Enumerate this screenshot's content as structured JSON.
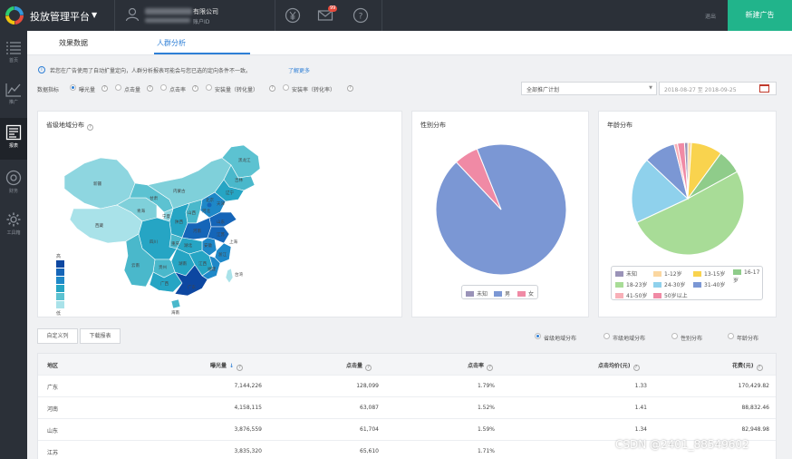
{
  "header": {
    "app_title": "投放管理平台",
    "company": "有限公司",
    "account": "账户ID",
    "mail_badge": "99",
    "top_link": "退出",
    "new_ad_label": "新建广告"
  },
  "sidebar": {
    "items": [
      {
        "label": "首页",
        "icon": "list-icon"
      },
      {
        "label": "推广",
        "icon": "trend-icon"
      },
      {
        "label": "报表",
        "icon": "report-icon",
        "active": true
      },
      {
        "label": "财务",
        "icon": "finance-icon"
      },
      {
        "label": "工具箱",
        "icon": "gear-icon"
      }
    ]
  },
  "tabs": [
    {
      "label": "效果数据"
    },
    {
      "label": "人群分析",
      "active": true
    }
  ],
  "notice": {
    "text": "若您在广告使用了自动扩量定向，人群分析报表可能会与您已选的定向条件不一致。",
    "link": "了解更多"
  },
  "metrics": {
    "label": "数据指标",
    "options": [
      "曝光量",
      "点击量",
      "点击率",
      "安装量（转化量）",
      "安装率（转化率）"
    ],
    "selected": "曝光量"
  },
  "filters": {
    "plan": "全部推广计划",
    "date_range": "2018-08-27 至 2018-09-25"
  },
  "panels": {
    "map_title": "省级地域分布",
    "gender_title": "性别分布",
    "age_title": "年龄分布",
    "map_legend_low": "低",
    "map_legend_high": "高"
  },
  "map_labels": [
    "新疆",
    "西藏",
    "青海",
    "甘肃",
    "内蒙古",
    "黑龙江",
    "吉林",
    "辽宁",
    "宁夏",
    "陕西",
    "山西",
    "河北",
    "北京",
    "天津",
    "山东",
    "河南",
    "四川",
    "重庆",
    "湖北",
    "安徽",
    "江苏",
    "上海",
    "浙江",
    "湖南",
    "江西",
    "贵州",
    "云南",
    "广西",
    "广东",
    "福建",
    "台湾",
    "海南"
  ],
  "gender": {
    "legend": [
      "未知",
      "男",
      "女"
    ],
    "colors": [
      "#9a93b8",
      "#7b97d4",
      "#f08aa5"
    ],
    "values": [
      0,
      94,
      6
    ]
  },
  "age": {
    "legend": [
      "未知",
      "1-12岁",
      "13-15岁",
      "16-17岁",
      "18-23岁",
      "24-30岁",
      "31-40岁",
      "41-50岁",
      "50岁以上"
    ],
    "colors": [
      "#9a93b8",
      "#fbd7a0",
      "#f9d34e",
      "#8fcc8a",
      "#a8dc97",
      "#8fd1ec",
      "#7b97d4",
      "#f8b0b8",
      "#f08aa5"
    ],
    "values": [
      1,
      1,
      9,
      7,
      51,
      19,
      9,
      1,
      2
    ]
  },
  "actions": {
    "custom_columns": "自定义列",
    "download": "下载报表"
  },
  "dimensions": {
    "options": [
      "省级地域分布",
      "市级地域分布",
      "性别分布",
      "年龄分布"
    ],
    "selected": "省级地域分布"
  },
  "table": {
    "columns": [
      "地区",
      "曝光量",
      "点击量",
      "点击率",
      "点击均价(元)",
      "花费(元)"
    ],
    "rows": [
      [
        "广东",
        "7,144,226",
        "128,099",
        "1.79%",
        "1.33",
        "170,429.82"
      ],
      [
        "河南",
        "4,158,115",
        "63,087",
        "1.52%",
        "1.41",
        "88,832.46"
      ],
      [
        "山东",
        "3,876,559",
        "61,704",
        "1.59%",
        "1.34",
        "82,948.98"
      ],
      [
        "江苏",
        "3,835,320",
        "65,610",
        "1.71%",
        "",
        ""
      ]
    ]
  },
  "watermark": "CSDN @2401_88549602"
}
